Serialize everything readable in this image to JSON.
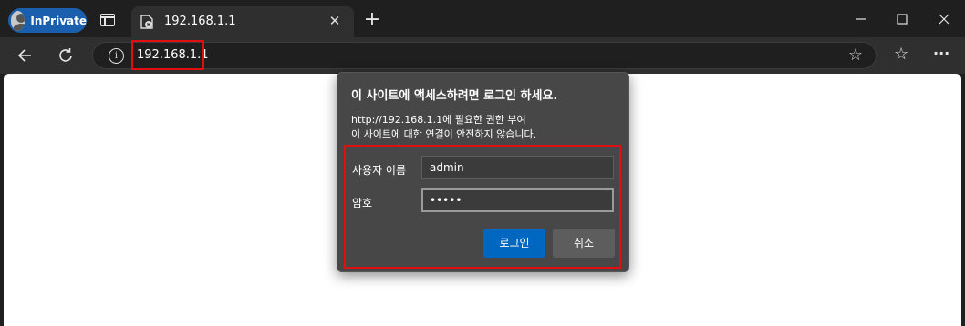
{
  "tabbar": {
    "inprivate_label": "InPrivate",
    "tab_title": "192.168.1.1",
    "close_glyph": "✕",
    "newtab_glyph": "+"
  },
  "window": {
    "minimize": "—",
    "maximize": "☐",
    "close": "✕"
  },
  "toolbar": {
    "url": "192.168.1.1",
    "info_glyph": "i",
    "favorite_glyph": "☆",
    "favorites_glyph": "☆",
    "more_glyph": "···"
  },
  "dialog": {
    "title": "이 사이트에 액세스하려면 로그인 하세요.",
    "line1": "http://192.168.1.1에 필요한 권한 부여",
    "line2": "이 사이트에 대한 연결이 안전하지 않습니다.",
    "username_label": "사용자 이름",
    "username_value": "admin",
    "password_label": "암호",
    "password_value": "•••••",
    "login_button": "로그인",
    "cancel_button": "취소"
  },
  "colors": {
    "accent": "#0067c0",
    "highlight": "#e01010"
  }
}
